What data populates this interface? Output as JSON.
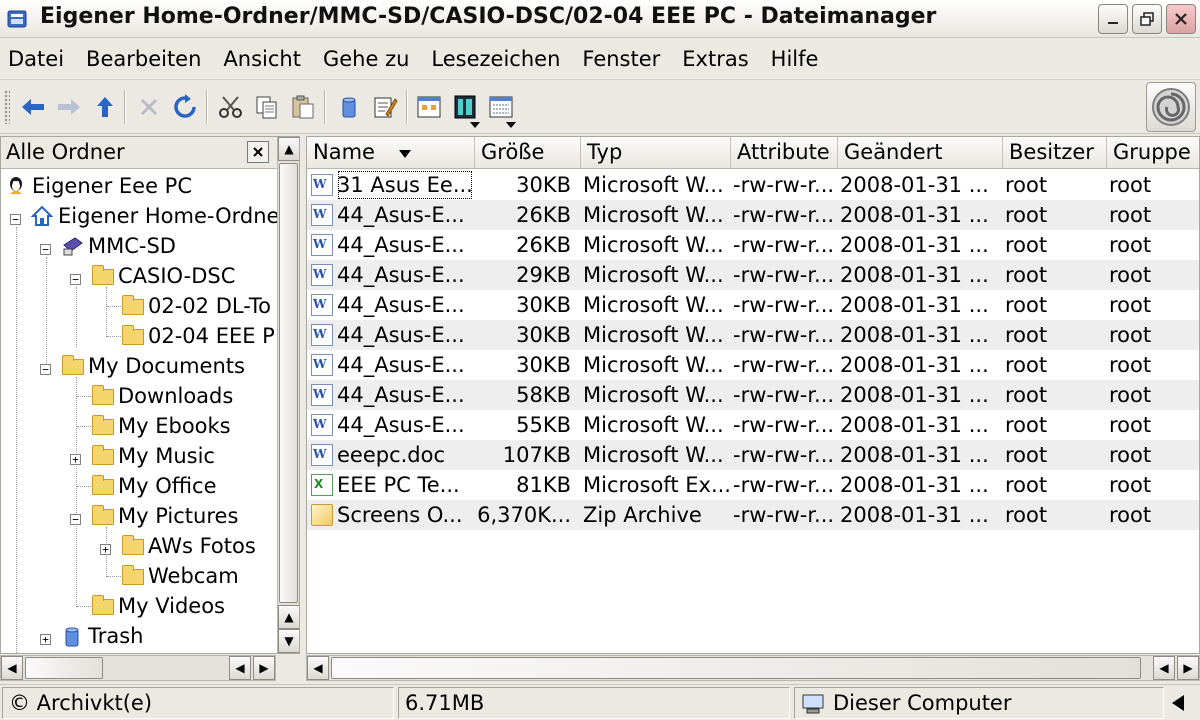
{
  "window": {
    "title": "Eigener Home-Ordner/MMC-SD/CASIO-DSC/02-04 EEE PC - Dateimanager"
  },
  "menu": [
    {
      "label": "Datei"
    },
    {
      "label": "Bearbeiten"
    },
    {
      "label": "Ansicht"
    },
    {
      "label": "Gehe zu"
    },
    {
      "label": "Lesezeichen"
    },
    {
      "label": "Fenster"
    },
    {
      "label": "Extras"
    },
    {
      "label": "Hilfe"
    }
  ],
  "sidebar": {
    "header": "Alle Ordner",
    "tree": [
      {
        "label": "Eigener Eee PC",
        "icon": "computer-icon"
      },
      {
        "label": "Eigener Home-Ordne",
        "icon": "home-icon"
      },
      {
        "label": "MMC-SD",
        "icon": "sd-card-icon"
      },
      {
        "label": "CASIO-DSC",
        "icon": "folder-icon"
      },
      {
        "label": "02-02 DL-To",
        "icon": "folder-icon"
      },
      {
        "label": "02-04 EEE P",
        "icon": "folder-open-icon"
      },
      {
        "label": "My Documents",
        "icon": "folder-icon"
      },
      {
        "label": "Downloads",
        "icon": "folder-icon"
      },
      {
        "label": "My Ebooks",
        "icon": "folder-icon"
      },
      {
        "label": "My Music",
        "icon": "folder-icon"
      },
      {
        "label": "My Office",
        "icon": "folder-icon"
      },
      {
        "label": "My Pictures",
        "icon": "folder-icon"
      },
      {
        "label": "AWs Fotos",
        "icon": "folder-icon"
      },
      {
        "label": "Webcam",
        "icon": "folder-icon"
      },
      {
        "label": "My Videos",
        "icon": "folder-icon"
      },
      {
        "label": "Trash",
        "icon": "trash-icon"
      }
    ]
  },
  "filelist": {
    "columns": [
      "Name",
      "Größe",
      "Typ",
      "Attribute",
      "Geändert",
      "Besitzer",
      "Gruppe"
    ],
    "rows": [
      {
        "name": "31 Asus Ee...",
        "size": "30KB",
        "type": "Microsoft W...",
        "attr": "-rw-rw-r...",
        "modified": "2008-01-31 ...",
        "owner": "root",
        "group": "root",
        "icon": "word-doc-icon"
      },
      {
        "name": "44_Asus-E...",
        "size": "26KB",
        "type": "Microsoft W...",
        "attr": "-rw-rw-r...",
        "modified": "2008-01-31 ...",
        "owner": "root",
        "group": "root",
        "icon": "word-doc-icon"
      },
      {
        "name": "44_Asus-E...",
        "size": "26KB",
        "type": "Microsoft W...",
        "attr": "-rw-rw-r...",
        "modified": "2008-01-31 ...",
        "owner": "root",
        "group": "root",
        "icon": "word-doc-icon"
      },
      {
        "name": "44_Asus-E...",
        "size": "29KB",
        "type": "Microsoft W...",
        "attr": "-rw-rw-r...",
        "modified": "2008-01-31 ...",
        "owner": "root",
        "group": "root",
        "icon": "word-doc-icon"
      },
      {
        "name": "44_Asus-E...",
        "size": "30KB",
        "type": "Microsoft W...",
        "attr": "-rw-rw-r...",
        "modified": "2008-01-31 ...",
        "owner": "root",
        "group": "root",
        "icon": "word-doc-icon"
      },
      {
        "name": "44_Asus-E...",
        "size": "30KB",
        "type": "Microsoft W...",
        "attr": "-rw-rw-r...",
        "modified": "2008-01-31 ...",
        "owner": "root",
        "group": "root",
        "icon": "word-doc-icon"
      },
      {
        "name": "44_Asus-E...",
        "size": "30KB",
        "type": "Microsoft W...",
        "attr": "-rw-rw-r...",
        "modified": "2008-01-31 ...",
        "owner": "root",
        "group": "root",
        "icon": "word-doc-icon"
      },
      {
        "name": "44_Asus-E...",
        "size": "58KB",
        "type": "Microsoft W...",
        "attr": "-rw-rw-r...",
        "modified": "2008-01-31 ...",
        "owner": "root",
        "group": "root",
        "icon": "word-doc-icon"
      },
      {
        "name": "44_Asus-E...",
        "size": "55KB",
        "type": "Microsoft W...",
        "attr": "-rw-rw-r...",
        "modified": "2008-01-31 ...",
        "owner": "root",
        "group": "root",
        "icon": "word-doc-icon"
      },
      {
        "name": "eeepc.doc",
        "size": "107KB",
        "type": "Microsoft W...",
        "attr": "-rw-rw-r...",
        "modified": "2008-01-31 ...",
        "owner": "root",
        "group": "root",
        "icon": "word-doc-icon"
      },
      {
        "name": "EEE PC Te...",
        "size": "81KB",
        "type": "Microsoft Ex...",
        "attr": "-rw-rw-r...",
        "modified": "2008-01-31 ...",
        "owner": "root",
        "group": "root",
        "icon": "excel-doc-icon"
      },
      {
        "name": "Screens O...",
        "size": "6,370K...",
        "type": "Zip Archive",
        "attr": "-rw-rw-r...",
        "modified": "2008-01-31 ...",
        "owner": "root",
        "group": "root",
        "icon": "zip-archive-icon"
      }
    ]
  },
  "statusbar": {
    "left": "© Archiv",
    "left_overlay": "kt(e)",
    "size": "6.71MB",
    "location": "Dieser Computer"
  },
  "colors": {
    "window_bg": "#ece9e2",
    "alt_row": "#eeeeee",
    "folder": "#f6d56d",
    "arrow_blue": "#2a64c5"
  }
}
